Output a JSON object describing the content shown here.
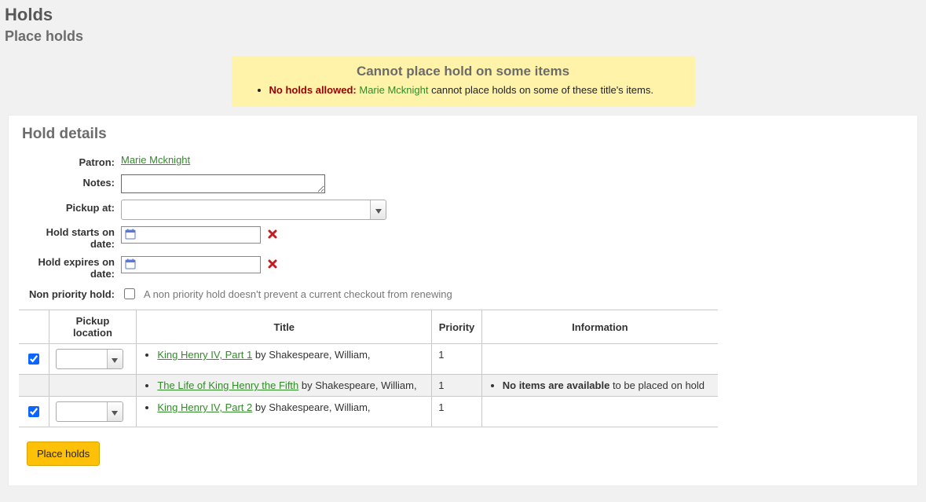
{
  "header": {
    "title": "Holds",
    "subtitle": "Place holds"
  },
  "alert": {
    "heading": "Cannot place hold on some items",
    "strong": "No holds allowed:",
    "link": "Marie Mcknight",
    "tail": " cannot place holds on some of these title's items."
  },
  "details": {
    "section_title": "Hold details",
    "patron_label": "Patron:",
    "patron_name": "Marie Mcknight",
    "notes_label": "Notes:",
    "notes_value": "",
    "pickup_label": "Pickup at:",
    "pickup_value": "",
    "start_label": "Hold starts on date:",
    "start_value": "",
    "expire_label": "Hold expires on date:",
    "expire_value": "",
    "nonprio_label": "Non priority hold:",
    "nonprio_hint": "A non priority hold doesn't prevent a current checkout from renewing"
  },
  "table": {
    "headers": {
      "pickup": "Pickup location",
      "title": "Title",
      "priority": "Priority",
      "info": "Information"
    },
    "rows": [
      {
        "checked": true,
        "has_pickup": true,
        "title_link": "King Henry IV, Part 1",
        "title_by": " by Shakespeare, William,",
        "priority": "1",
        "info_strong": "",
        "info_tail": ""
      },
      {
        "checked": false,
        "has_pickup": false,
        "muted": true,
        "title_link": "The Life of King Henry the Fifth",
        "title_by": " by Shakespeare, William,",
        "priority": "1",
        "info_strong": "No items are available",
        "info_tail": " to be placed on hold"
      },
      {
        "checked": true,
        "has_pickup": true,
        "title_link": "King Henry IV, Part 2",
        "title_by": " by Shakespeare, William,",
        "priority": "1",
        "info_strong": "",
        "info_tail": ""
      }
    ]
  },
  "action": {
    "place_holds": "Place holds"
  }
}
